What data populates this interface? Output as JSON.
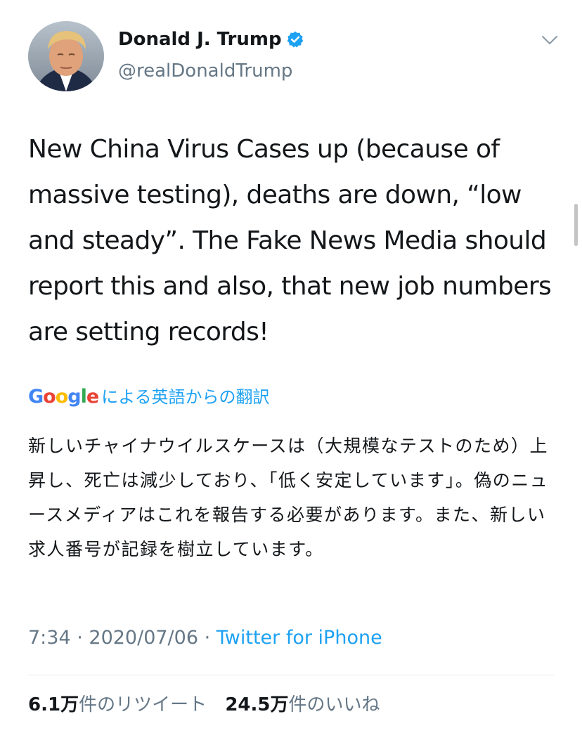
{
  "user": {
    "display_name": "Donald J. Trump",
    "handle": "@realDonaldTrump",
    "verified": true
  },
  "tweet": {
    "text": "New China Virus Cases up (because of massive testing), deaths are down, “low and steady”. The Fake News Media should report this and also, that new job numbers are setting records!"
  },
  "translation": {
    "logo_letters": [
      {
        "char": "G",
        "color": "#4285F4"
      },
      {
        "char": "o",
        "color": "#EA4335"
      },
      {
        "char": "o",
        "color": "#FBBC05"
      },
      {
        "char": "g",
        "color": "#4285F4"
      },
      {
        "char": "l",
        "color": "#34A853"
      },
      {
        "char": "e",
        "color": "#EA4335"
      }
    ],
    "label": "による英語からの翻訳",
    "text": "新しいチャイナウイルスケースは（大規模なテストのため）上昇し、死亡は減少しており、「低く安定しています」。偽のニュースメディアはこれを報告する必要があります。また、新しい求人番号が記録を樹立しています。"
  },
  "meta": {
    "time": "7:34",
    "separator1": " · ",
    "date": "2020/07/06",
    "separator2": " · ",
    "source": "Twitter for iPhone"
  },
  "stats": {
    "retweets_num": "6.1万",
    "retweets_label": "件のリツイート",
    "likes_num": "24.5万",
    "likes_label": "件のいいね"
  },
  "icons": {
    "verified": "verified-badge-icon",
    "caret": "chevron-down-icon",
    "avatar": "profile-photo"
  },
  "colors": {
    "accent": "#1DA1F2",
    "text_primary": "#14171A",
    "text_secondary": "#657786",
    "divider": "#E1E8ED"
  }
}
